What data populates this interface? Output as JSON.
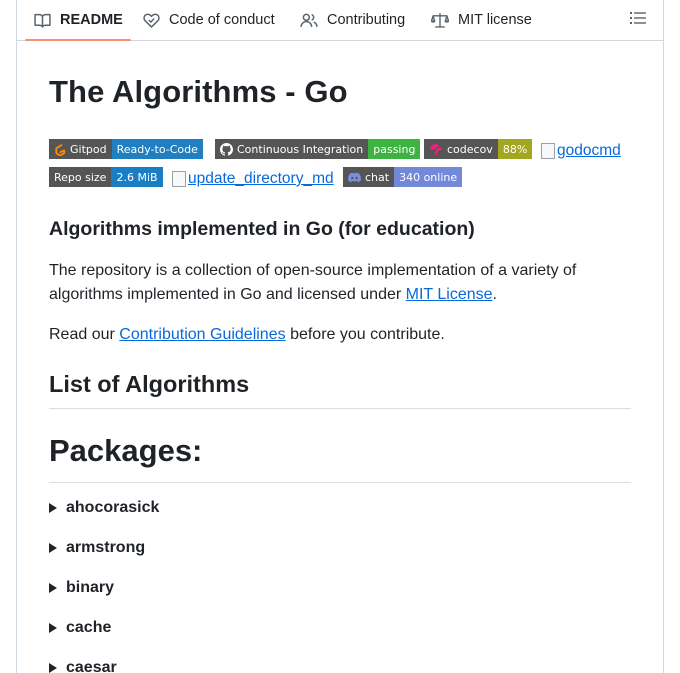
{
  "tabs": [
    {
      "label": "README",
      "icon": "book-icon",
      "active": true
    },
    {
      "label": "Code of conduct",
      "icon": "code-of-conduct-icon"
    },
    {
      "label": "Contributing",
      "icon": "people-icon"
    },
    {
      "label": "MIT license",
      "icon": "law-scale-icon"
    }
  ],
  "outline_icon": "list-unordered-icon",
  "readme": {
    "title": "The Algorithms - Go",
    "badges": [
      {
        "left": "Gitpod",
        "right": "Ready-to-Code",
        "right_color": "#1f7fc1",
        "icon": "gitpod-icon"
      },
      {
        "left": "Continuous Integration",
        "right": "passing",
        "right_color": "#3cb342",
        "icon": "github-icon"
      },
      {
        "left": "codecov",
        "right": "88%",
        "right_color": "#a3a61f",
        "icon": "codecov-icon"
      },
      {
        "left": "Repo size",
        "right": "2.6 MiB",
        "right_color": "#1a7ec4"
      },
      {
        "left": "chat",
        "right": "340 online",
        "right_color": "#7289da",
        "icon": "discord-icon"
      }
    ],
    "broken_images": [
      "godocmd",
      "update_directory_md"
    ],
    "subtitle": "Algorithms implemented in Go (for education)",
    "description_text": "The repository is a collection of open-source implementation of a variety of algorithms implemented in Go and licensed under",
    "license_link": "MIT License",
    "description_end": ".",
    "read_prefix": "Read our",
    "contrib_link": "Contribution Guidelines",
    "read_suffix": "before you contribute.",
    "list_heading": "List of Algorithms",
    "packages_heading": "Packages:",
    "packages": [
      "ahocorasick",
      "armstrong",
      "binary",
      "cache",
      "caesar"
    ]
  }
}
